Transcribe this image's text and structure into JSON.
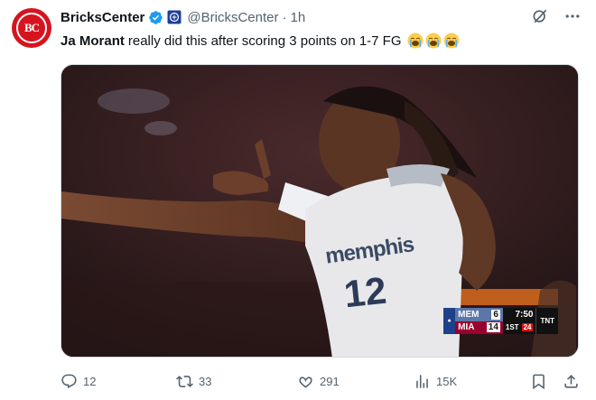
{
  "tweet": {
    "author": {
      "display_name": "BricksCenter",
      "handle": "@BricksCenter",
      "avatar_text": "BC",
      "avatar_color": "#d5141f"
    },
    "separator": "·",
    "time": "1h",
    "text_bold": "Ja Morant",
    "text_rest": "really did this after scoring 3 points on 1-7 FG",
    "emojis": [
      "loudly-crying-face",
      "loudly-crying-face",
      "loudly-crying-face"
    ],
    "media": {
      "jersey_text": "memphis",
      "jersey_number": "12",
      "scorebug": {
        "team1": "MEM",
        "score1": "6",
        "team2": "MIA",
        "score2": "14",
        "clock": "7:50",
        "period": "1ST",
        "shot_clock": "24",
        "network": "TNT"
      }
    },
    "actions": {
      "replies": "12",
      "reposts": "33",
      "likes": "291",
      "views": "15K"
    }
  },
  "colors": {
    "verified_blue": "#1d9bf0",
    "muted_text": "#536471",
    "accent_red": "#d5141f"
  }
}
